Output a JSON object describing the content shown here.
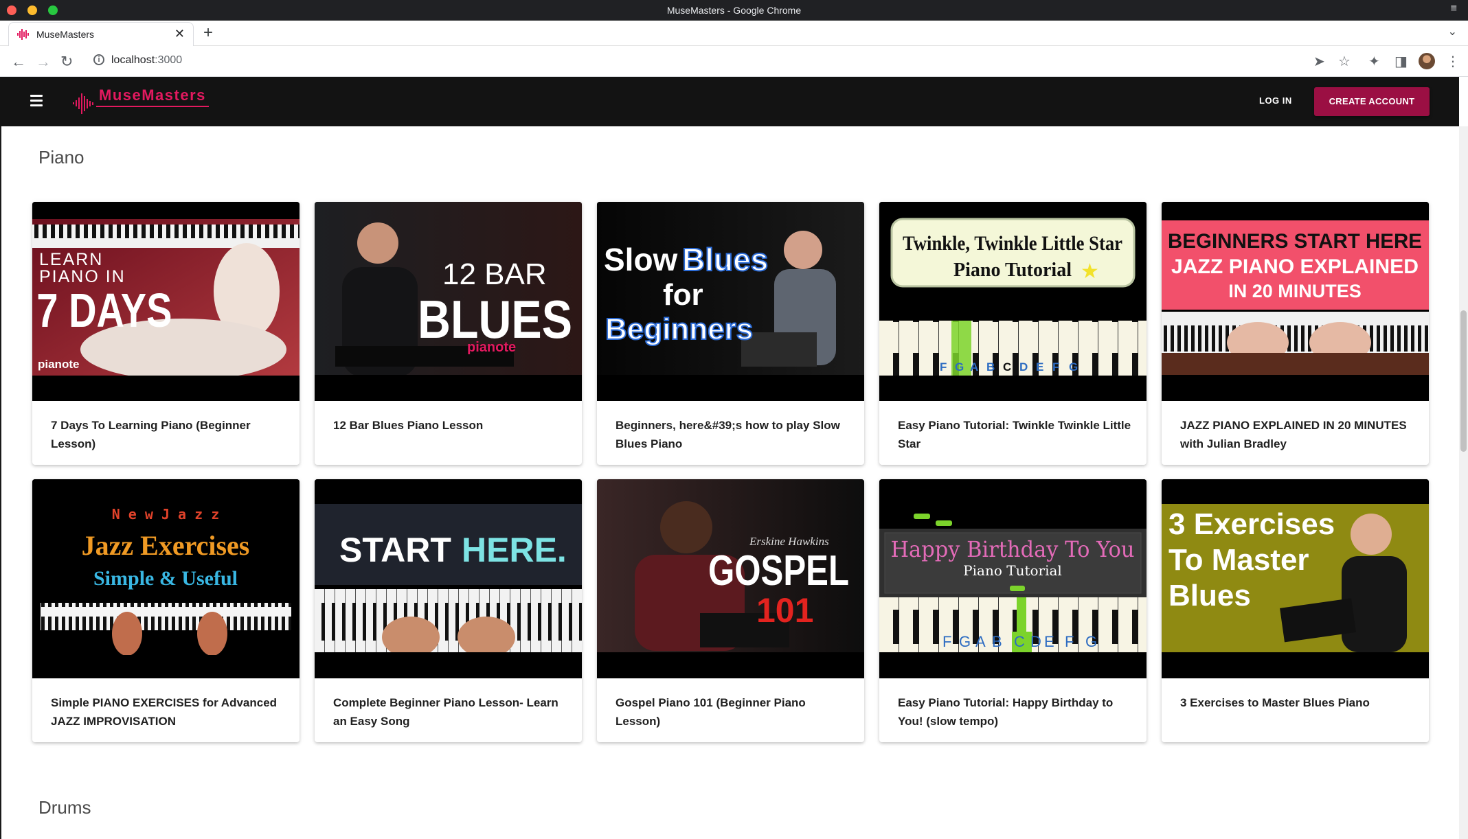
{
  "window": {
    "title": "MuseMasters - Google Chrome"
  },
  "browser": {
    "tab_title": "MuseMasters",
    "url_host": "localhost",
    "url_port": ":3000"
  },
  "header": {
    "logo_text": "MuseMasters",
    "login_label": "LOG IN",
    "create_account_label": "CREATE ACCOUNT",
    "accent_color": "#e3195f",
    "button_color": "#9b0f43"
  },
  "sections": [
    {
      "title": "Piano",
      "videos": [
        {
          "title": "7 Days To Learning Piano (Beginner Lesson)",
          "thumb_lines": [
            "LEARN",
            "PIANO IN",
            "7 DAYS",
            "pianote"
          ]
        },
        {
          "title": "12 Bar Blues Piano Lesson",
          "thumb_lines": [
            "12 BAR",
            "BLUES",
            "pianote"
          ]
        },
        {
          "title": "Beginners, here&#39;s how to play Slow Blues Piano",
          "thumb_lines": [
            "Slow",
            "Blues",
            "for",
            "Beginners"
          ]
        },
        {
          "title": "Easy Piano Tutorial: Twinkle Twinkle Little Star",
          "thumb_lines": [
            "Twinkle, Twinkle Little Star",
            "Piano Tutorial",
            "F",
            "G",
            "A",
            "B",
            "C",
            "D",
            "E",
            "F",
            "G"
          ]
        },
        {
          "title": "JAZZ PIANO EXPLAINED IN 20 MINUTES with Julian Bradley",
          "thumb_lines": [
            "BEGINNERS START HERE",
            "JAZZ PIANO EXPLAINED",
            "IN 20 MINUTES"
          ]
        },
        {
          "title": "Simple PIANO EXERCISES for Advanced JAZZ IMPROVISATION",
          "thumb_lines": [
            "N e w J a z z",
            "Jazz Exercises",
            "Simple & Useful"
          ]
        },
        {
          "title": "Complete Beginner Piano Lesson- Learn an Easy Song",
          "thumb_lines": [
            "START",
            "HERE."
          ]
        },
        {
          "title": "Gospel Piano 101 (Beginner Piano Lesson)",
          "thumb_lines": [
            "Erskine Hawkins",
            "GOSPEL",
            "101"
          ]
        },
        {
          "title": "Easy Piano Tutorial: Happy Birthday to You! (slow tempo)",
          "thumb_lines": [
            "Happy Birthday To You",
            "Piano Tutorial",
            "F",
            "G",
            "A",
            "B",
            "C",
            "D",
            "E",
            "F",
            "G"
          ]
        },
        {
          "title": "3 Exercises to Master Blues Piano",
          "thumb_lines": [
            "3 Exercises",
            "To Master",
            "Blues"
          ]
        }
      ]
    },
    {
      "title": "Drums",
      "videos": []
    }
  ]
}
